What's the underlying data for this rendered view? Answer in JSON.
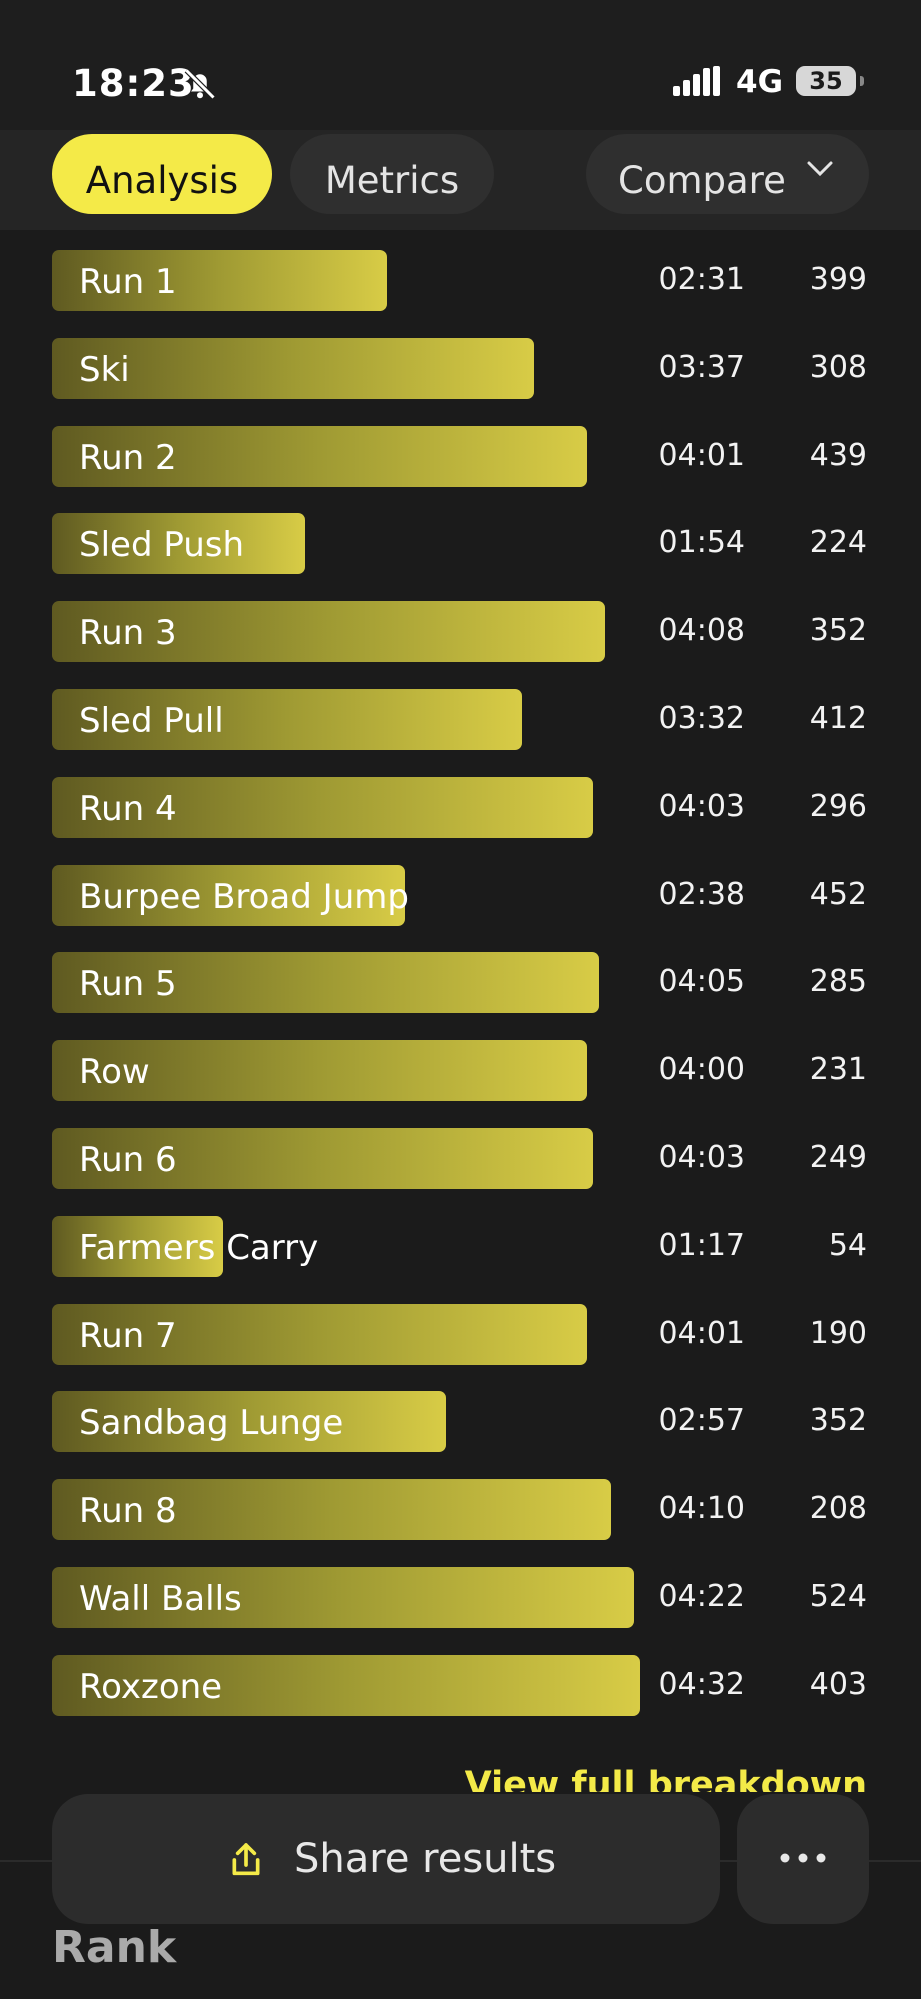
{
  "status": {
    "time": "18:23",
    "network": "4G",
    "battery": "35"
  },
  "tabs": [
    {
      "label": "Analysis"
    },
    {
      "label": "Metrics"
    },
    {
      "label": "Compare"
    }
  ],
  "rows": [
    {
      "name": "Run 1",
      "time": "02:31",
      "score": "399",
      "bar_fraction": 0.57
    },
    {
      "name": "Ski",
      "time": "03:37",
      "score": "308",
      "bar_fraction": 0.82
    },
    {
      "name": "Run 2",
      "time": "04:01",
      "score": "439",
      "bar_fraction": 0.91
    },
    {
      "name": "Sled Push",
      "time": "01:54",
      "score": "224",
      "bar_fraction": 0.43
    },
    {
      "name": "Run 3",
      "time": "04:08",
      "score": "352",
      "bar_fraction": 0.94
    },
    {
      "name": "Sled Pull",
      "time": "03:32",
      "score": "412",
      "bar_fraction": 0.8
    },
    {
      "name": "Run 4",
      "time": "04:03",
      "score": "296",
      "bar_fraction": 0.92
    },
    {
      "name": "Burpee Broad Jump",
      "time": "02:38",
      "score": "452",
      "bar_fraction": 0.6
    },
    {
      "name": "Run 5",
      "time": "04:05",
      "score": "285",
      "bar_fraction": 0.93
    },
    {
      "name": "Row",
      "time": "04:00",
      "score": "231",
      "bar_fraction": 0.91
    },
    {
      "name": "Run 6",
      "time": "04:03",
      "score": "249",
      "bar_fraction": 0.92
    },
    {
      "name": "Farmers Carry",
      "time": "01:17",
      "score": "54",
      "bar_fraction": 0.29
    },
    {
      "name": "Run 7",
      "time": "04:01",
      "score": "190",
      "bar_fraction": 0.91
    },
    {
      "name": "Sandbag Lunge",
      "time": "02:57",
      "score": "352",
      "bar_fraction": 0.67
    },
    {
      "name": "Run 8",
      "time": "04:10",
      "score": "208",
      "bar_fraction": 0.95
    },
    {
      "name": "Wall Balls",
      "time": "04:22",
      "score": "524",
      "bar_fraction": 0.99
    },
    {
      "name": "Roxzone",
      "time": "04:32",
      "score": "403",
      "bar_fraction": 1.0
    }
  ],
  "breakdown_link": "View full breakdown",
  "share": {
    "label": "Share results"
  },
  "rank_heading": "Rank"
}
